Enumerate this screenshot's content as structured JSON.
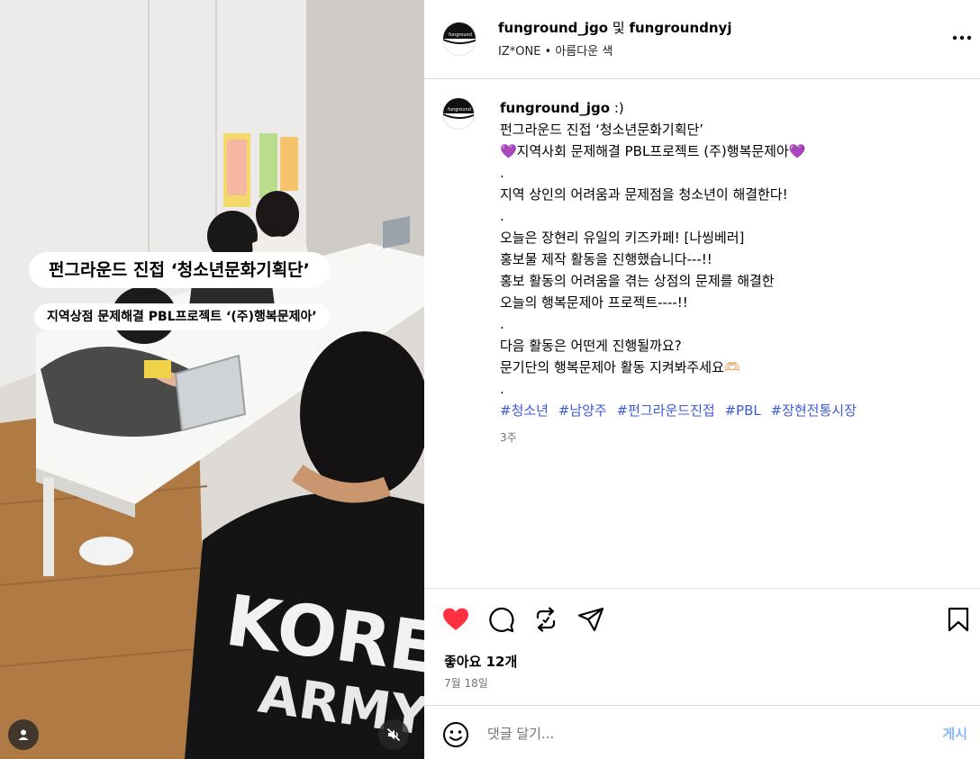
{
  "media": {
    "caption_title": "펀그라운드 진접 ‘청소년문화기획단’",
    "caption_subtitle": "지역상점 문제해결 PBL프로젝트 ‘(주)행복문제아’",
    "shirt_text_top": "KORE",
    "shirt_text_bottom": "ARMY",
    "icons": {
      "user": "user-icon",
      "mute": "speaker-muted-icon"
    }
  },
  "header": {
    "logo_text": "funground",
    "author": "funground_jgo",
    "connector": " 및 ",
    "coauthor": "fungroundnyj",
    "music": "IZ*ONE • 아름다운 색",
    "more_icon": "more-options-icon"
  },
  "caption": {
    "username": "funground_jgo",
    "first_line_suffix": " :)",
    "lines": [
      "펀그라운드 진접 ‘청소년문화기획단’",
      "💜지역사회 문제해결 PBL프로젝트 (주)행복문제아💜",
      ".",
      "지역 상인의 어려움과 문제점을 청소년이 해결한다!",
      ".",
      "오늘은 장현리 유일의 키즈카페! [나씽베러]",
      "홍보물 제작 활동을 진행했습니다---!!",
      "홍보 활동의 어려움을 겪는 상점의 문제를 해결한",
      "오늘의 행복문제아 프로젝트----!!",
      ".",
      "다음 활동은 어떤게 진행될까요?",
      "문기단의 행복문제아 활동 지켜봐주세요🫶🏻",
      "."
    ],
    "hashtags": [
      "#청소년",
      "#남양주",
      "#펀그라운드진접",
      "#PBL",
      "#장현전통시장"
    ],
    "time_ago": "3주"
  },
  "actions": {
    "liked": true,
    "like_color": "#ff3040",
    "icons": [
      "heart-icon",
      "comment-icon",
      "repost-icon",
      "share-icon",
      "bookmark-icon"
    ],
    "likes_text": "좋아요 12개",
    "date": "7월 18일"
  },
  "comment": {
    "placeholder": "댓글 달기...",
    "post_label": "게시",
    "emoji_icon": "emoji-icon"
  }
}
